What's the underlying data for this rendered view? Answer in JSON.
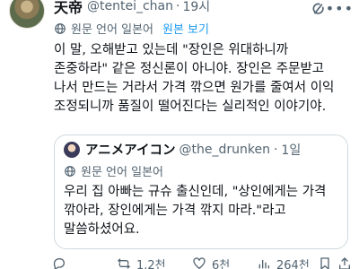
{
  "tweet": {
    "display_name": "天帝",
    "handle": "@tentei_chan",
    "separator": "·",
    "time": "19시",
    "original_language": "원문 언어 일본어",
    "view_original": "원본 보기",
    "text_lines": [
      "이 말, 오해받고 있는데 \"장인은 위대하니까",
      "존중하라\" 같은 정신론이 아니야. 장인은 주문받고",
      "나서 만드는 거라서 가격 깎으면 원가를 줄여서 이익",
      "조정되니까 품질이 떨어진다는 실리적인 이야기야."
    ]
  },
  "quote": {
    "display_name": "アニメアイコン",
    "handle": "@the_drunken",
    "separator": "·",
    "time": "1일",
    "original_language": "원문 언어 일본어",
    "text_lines": [
      "우리 집 아빠는 규슈 출신인데, \"상인에게는 가격",
      "깎아라, 장인에게는 가격 깎지 마라.\"라고",
      "말씀하셨어요."
    ]
  },
  "actions": {
    "reply_count": "",
    "retweet_count": "1.2천",
    "like_count": "6천",
    "views_count": "264천"
  },
  "colors": {
    "text": "#0f1419",
    "secondary": "#536471",
    "link": "#1d9bf0",
    "border": "#cfd9de"
  }
}
